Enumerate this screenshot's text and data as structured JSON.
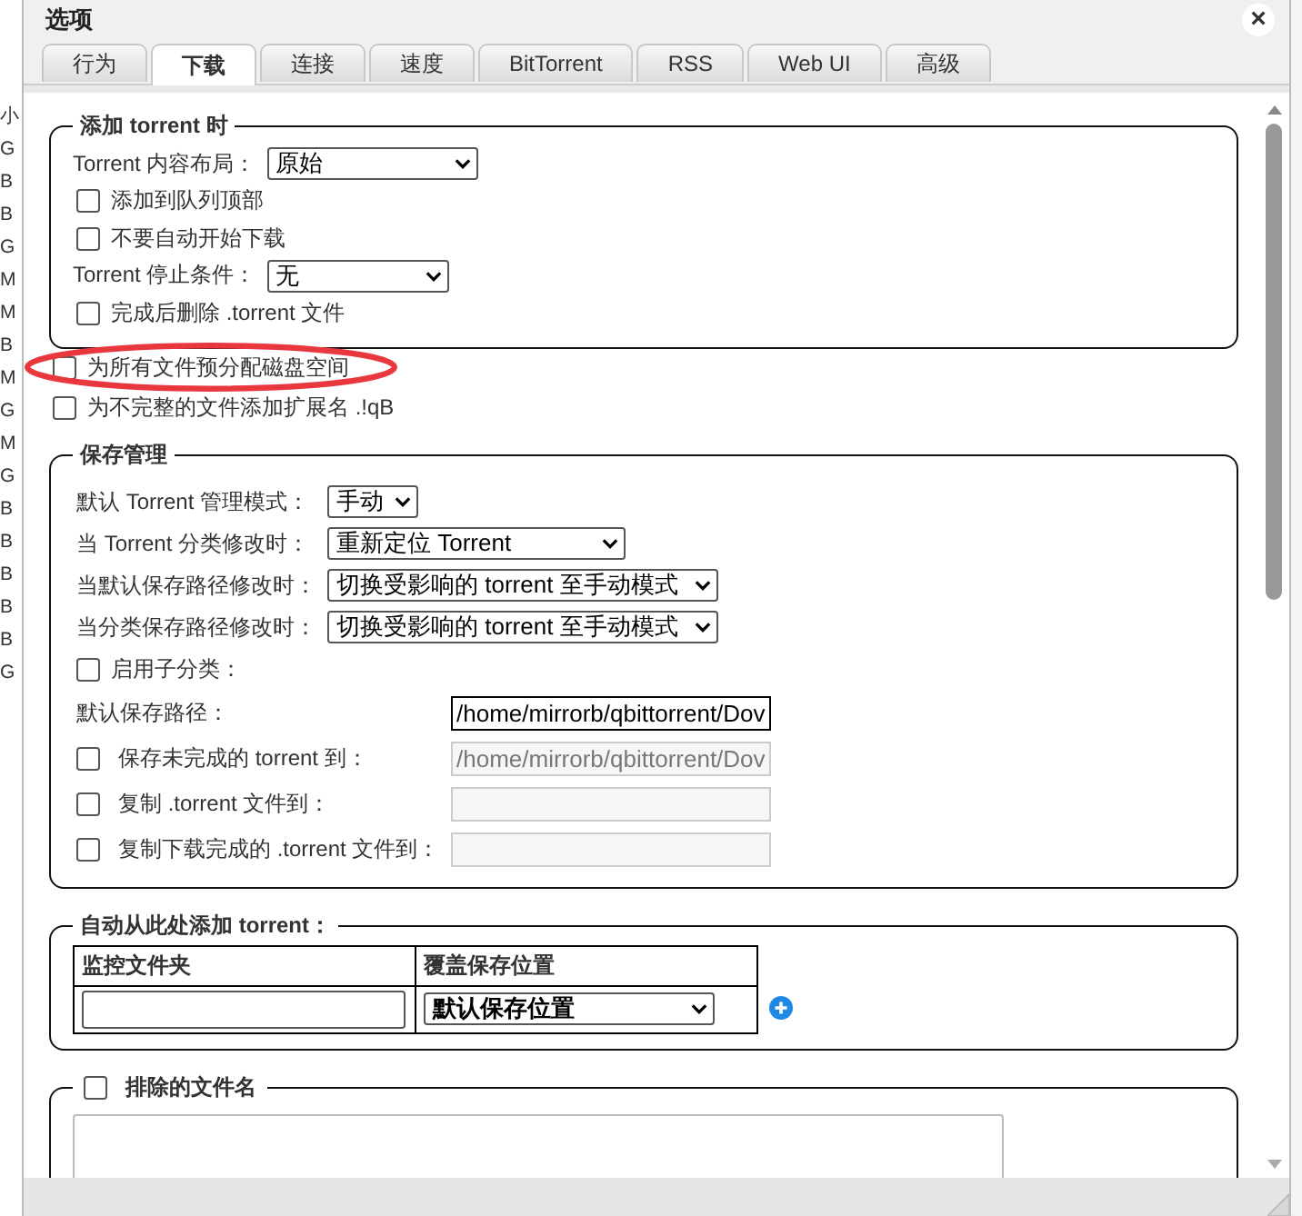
{
  "background_rows": [
    "小",
    "G",
    "B",
    "B",
    "G",
    "M",
    "M",
    "B",
    "M",
    "G",
    "M",
    "G",
    "B",
    "B",
    "B",
    "B",
    "B",
    "G"
  ],
  "window": {
    "title": "选项",
    "close": "×"
  },
  "tabs": [
    {
      "label": "行为",
      "selected": false
    },
    {
      "label": "下载",
      "selected": true
    },
    {
      "label": "连接",
      "selected": false
    },
    {
      "label": "速度",
      "selected": false
    },
    {
      "label": "BitTorrent",
      "selected": false
    },
    {
      "label": "RSS",
      "selected": false
    },
    {
      "label": "Web UI",
      "selected": false
    },
    {
      "label": "高级",
      "selected": false
    }
  ],
  "add_torrent": {
    "legend": "添加 torrent 时",
    "rows": [
      {
        "kind": "select",
        "label": "Torrent 内容布局：",
        "value": "原始"
      },
      {
        "kind": "checkbox",
        "label": "添加到队列顶部",
        "checked": false
      },
      {
        "kind": "checkbox",
        "label": "不要自动开始下载",
        "checked": false
      },
      {
        "kind": "select",
        "label": "Torrent 停止条件：",
        "value": "无"
      },
      {
        "kind": "checkbox",
        "label": "完成后删除 .torrent 文件",
        "checked": false
      }
    ]
  },
  "options": [
    {
      "label": "为所有文件预分配磁盘空间",
      "checked": false,
      "highlighted": true
    },
    {
      "label": "为不完整的文件添加扩展名 .!qB",
      "checked": false,
      "highlighted": false
    }
  ],
  "save_management": {
    "legend": "保存管理",
    "rows": [
      {
        "kind": "select",
        "label": "默认 Torrent 管理模式：",
        "value": "手动"
      },
      {
        "kind": "select",
        "label": "当 Torrent 分类修改时：",
        "value": "重新定位 Torrent"
      },
      {
        "kind": "select",
        "label": "当默认保存路径修改时：",
        "value": "切换受影响的 torrent 至手动模式"
      },
      {
        "kind": "select",
        "label": "当分类保存路径修改时：",
        "value": "切换受影响的 torrent 至手动模式"
      },
      {
        "kind": "checkbox",
        "label": "启用子分类：",
        "checked": false
      },
      {
        "kind": "path",
        "label": "默认保存路径：",
        "value": "/home/mirrorb/qbittorrent/Dov",
        "disabled": false
      },
      {
        "kind": "checkpath",
        "label": "保存未完成的 torrent 到：",
        "checked": false,
        "value": "/home/mirrorb/qbittorrent/Dov",
        "disabled": true
      },
      {
        "kind": "checkpath",
        "label": "复制 .torrent 文件到：",
        "checked": false,
        "disabled": true
      },
      {
        "kind": "checkpath",
        "label": "复制下载完成的 .torrent 文件到：",
        "checked": false,
        "disabled": true
      }
    ]
  },
  "watch_folders": {
    "legend": "自动从此处添加 torrent：",
    "columns": [
      "监控文件夹",
      "覆盖保存位置"
    ],
    "row": {
      "save_location": "默认保存位置"
    }
  },
  "excluded": {
    "legend": "排除的文件名",
    "checked": false
  }
}
